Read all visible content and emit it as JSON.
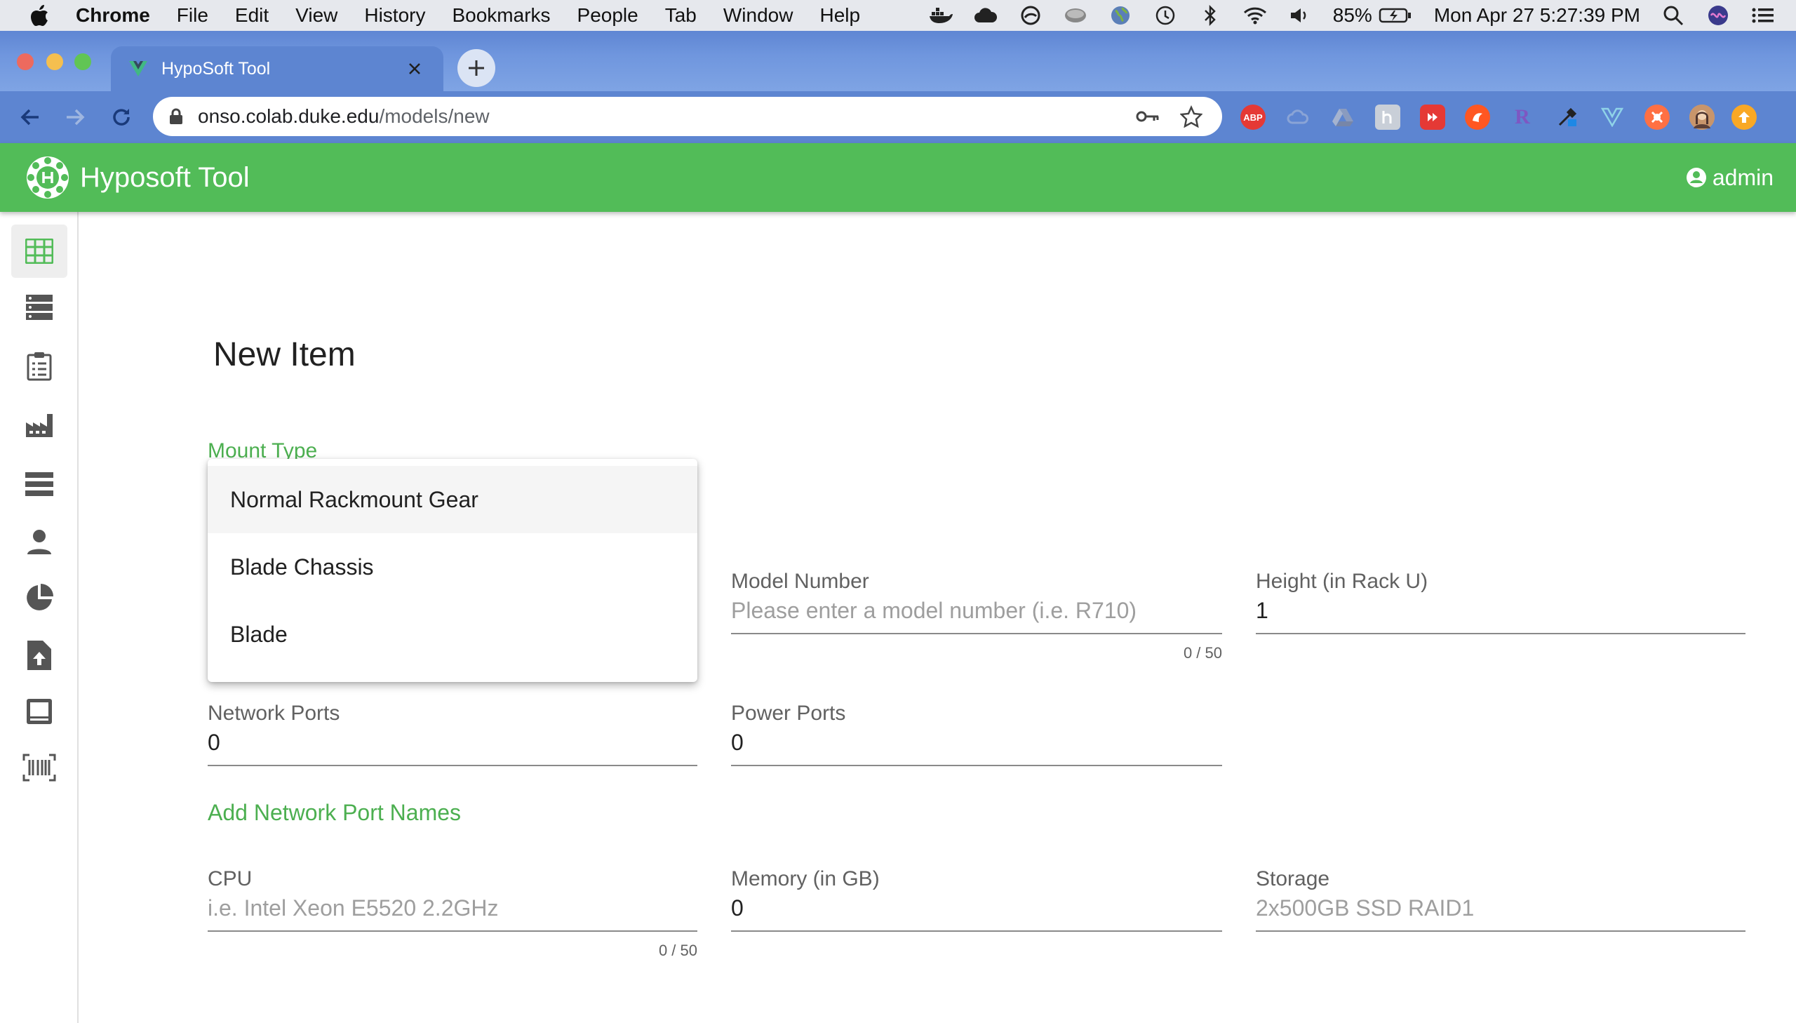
{
  "menubar": {
    "app_name": "Chrome",
    "menus": [
      "File",
      "Edit",
      "View",
      "History",
      "Bookmarks",
      "People",
      "Tab",
      "Window",
      "Help"
    ],
    "battery": "85%",
    "clock": "Mon Apr 27  5:27:39 PM",
    "status_icons": [
      "docker-icon",
      "creative-cloud-icon",
      "vpn-icon",
      "drive-icon",
      "globe-icon",
      "time-machine-icon",
      "bluetooth-icon",
      "wifi-icon",
      "volume-icon",
      "battery-icon",
      "spotlight-icon",
      "siri-icon",
      "control-center-icon"
    ]
  },
  "browser": {
    "tab_title": "HypoSoft Tool",
    "url_host": "onso.colab.duke.edu",
    "url_path": "/models/new",
    "extension_labels": {
      "abp": "ABP",
      "r": "R"
    }
  },
  "app": {
    "title": "Hyposoft Tool",
    "user": "admin",
    "brand_color": "#52bc58",
    "sidebar_icons": [
      "grid-icon",
      "server-list-icon",
      "clipboard-list-icon",
      "factory-icon",
      "rack-icon",
      "person-icon",
      "pie-chart-icon",
      "file-upload-icon",
      "monitor-icon",
      "barcode-icon"
    ]
  },
  "form": {
    "page_title": "New Item",
    "mount_type_label": "Mount Type",
    "mount_options": [
      "Normal Rackmount Gear",
      "Blade Chassis",
      "Blade"
    ],
    "model_number": {
      "label": "Model Number",
      "placeholder": "Please enter a model number (i.e. R710)",
      "counter": "0 / 50"
    },
    "height": {
      "label": "Height (in Rack U)",
      "value": "1"
    },
    "network_ports": {
      "label": "Network Ports",
      "value": "0"
    },
    "power_ports": {
      "label": "Power Ports",
      "value": "0"
    },
    "add_network_port_names": "Add Network Port Names",
    "cpu": {
      "label": "CPU",
      "placeholder": "i.e. Intel Xeon E5520 2.2GHz",
      "counter": "0 / 50"
    },
    "memory": {
      "label": "Memory (in GB)",
      "value": "0"
    },
    "storage": {
      "label": "Storage",
      "placeholder": "2x500GB SSD RAID1"
    }
  }
}
